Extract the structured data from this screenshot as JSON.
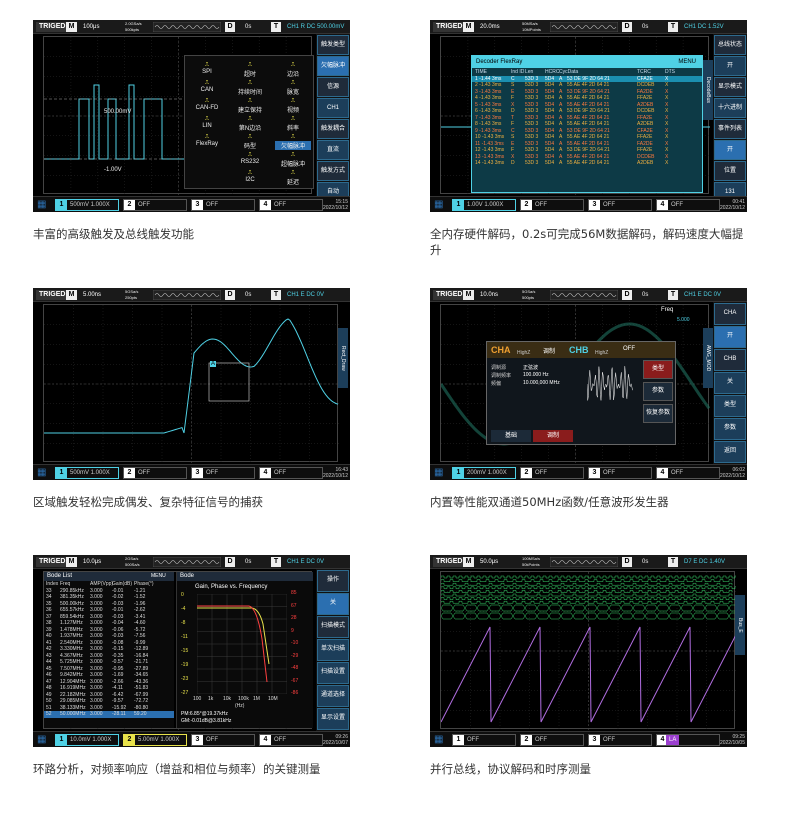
{
  "panels": [
    {
      "id": "trigger",
      "caption": "丰富的高级触发及总线触发功能",
      "status": {
        "mode": "TRIGED",
        "run": "M",
        "timebase": "100μs",
        "sample": "2.0GSa/s",
        "mem": "500kpts",
        "trig_type": "D",
        "delay": "0s",
        "trig_label": "T",
        "trig_info": "CH1 R DC 500.00mV"
      },
      "labels": {
        "level1": "500.00mV",
        "level2": "-1.00V"
      },
      "trigger_menu": [
        [
          "SPI",
          "超时",
          "边沿"
        ],
        [
          "CAN",
          "持续时间",
          "脉宽"
        ],
        [
          "CAN-FD",
          "建立保持",
          "视频"
        ],
        [
          "LIN",
          "第N边沿",
          "斜率"
        ],
        [
          "FlexRay",
          "码型",
          "欠幅脉冲"
        ],
        [
          "",
          "RS232",
          "超幅脉冲"
        ],
        [
          "",
          "I2C",
          "延迟"
        ]
      ],
      "menu_highlight": "欠幅脉冲",
      "side": [
        {
          "label": "触发类型",
          "style": "hd"
        },
        {
          "label": "欠幅脉冲",
          "style": "act"
        },
        {
          "label": "信源",
          "style": "hd"
        },
        {
          "label": "CH1",
          "style": ""
        },
        {
          "label": "触发耦合",
          "style": "hd"
        },
        {
          "label": "直流",
          "style": ""
        },
        {
          "label": "触发方式",
          "style": "hd"
        },
        {
          "label": "自动",
          "style": ""
        },
        {
          "label": "触发极性",
          "style": "hd"
        },
        {
          "label": "负极性",
          "style": ""
        }
      ],
      "channels": [
        {
          "n": "1",
          "label": "500mV 1.000X",
          "state": "on"
        },
        {
          "n": "2",
          "label": "OFF",
          "state": ""
        },
        {
          "n": "3",
          "label": "OFF",
          "state": ""
        },
        {
          "n": "4",
          "label": "OFF",
          "state": ""
        }
      ],
      "clock": {
        "time": "15:15",
        "date": "2022/10/12"
      }
    },
    {
      "id": "decode",
      "caption": "全内存硬件解码，0.2s可完成56M数据解码，解码速度大幅提升",
      "status": {
        "mode": "TRIGED",
        "run": "M",
        "timebase": "20.0ms",
        "sample": "50MSa/s",
        "mem": "10MPoints",
        "trig_type": "D",
        "delay": "0s",
        "trig_label": "T",
        "trig_info": "CH1 DC 1.52V"
      },
      "table_title": "Decoder FlexRay",
      "table_menu": "MENU",
      "table_header": [
        "TIME",
        "Ind ID",
        "Len",
        "HCRC",
        "CycData",
        "",
        "TCRC",
        "DTS"
      ],
      "table_rows": [
        [
          "1 -1.44 3ms",
          "C",
          "53D 3",
          "5D4",
          "A",
          "53 DE 9F 2D 64 21",
          "CFA2E",
          "X"
        ],
        [
          "2 -1.43 3ms",
          "S",
          "53D 3",
          "5D4",
          "A",
          "55 AE 4F 2D 64 21",
          "DCDEB",
          "X"
        ],
        [
          "3 -1.43 3ms",
          "E",
          "53D 3",
          "5D4",
          "A",
          "53 DE 9F 2D 64 21",
          "FA2DE",
          "X"
        ],
        [
          "4 -1.43 3ms",
          "F",
          "53D 3",
          "5D4",
          "A",
          "55 AE 4F 2D 64 21",
          "FFA2E",
          "X"
        ],
        [
          "5 -1.43 3ms",
          "X",
          "53D 3",
          "5D4",
          "A",
          "55 AE 4F 2D 64 21",
          "A2DEB",
          "X"
        ],
        [
          "6 -1.43 3ms",
          "D",
          "53D 3",
          "5D4",
          "A",
          "53 DE 9F 2D 64 21",
          "DCDEB",
          "X"
        ],
        [
          "7 -1.43 3ms",
          "T",
          "53D 3",
          "5D4",
          "A",
          "55 AE 4F 2D 64 21",
          "FFA2E",
          "X"
        ],
        [
          "8 -1.43 3ms",
          "F",
          "53D 3",
          "5D4",
          "A",
          "55 AE 4F 2D 64 21",
          "A2DEB",
          "X"
        ],
        [
          "9 -1.43 3ms",
          "C",
          "53D 3",
          "5D4",
          "A",
          "53 DE 9F 2D 64 21",
          "CFA2E",
          "X"
        ],
        [
          "10 -1.43 3ms",
          "S",
          "53D 3",
          "5D4",
          "A",
          "55 AE 4F 2D 64 21",
          "FFA2E",
          "X"
        ],
        [
          "11 -1.43 3ms",
          "E",
          "53D 3",
          "5D4",
          "A",
          "55 AE 4F 2D 64 21",
          "FA2DE",
          "X"
        ],
        [
          "12 -1.43 3ms",
          "F",
          "53D 3",
          "5D4",
          "A",
          "53 DE 9F 2D 64 21",
          "FFA2E",
          "X"
        ],
        [
          "13 -1.43 3ms",
          "X",
          "53D 3",
          "5D4",
          "A",
          "55 AE 4F 2D 64 21",
          "DCDEB",
          "X"
        ],
        [
          "14 -1.43 3ms",
          "D",
          "53D 3",
          "5D4",
          "A",
          "55 AE 4F 2D 64 21",
          "A2DEB",
          "X"
        ]
      ],
      "side": [
        {
          "label": "总线状态",
          "style": "hd"
        },
        {
          "label": "开",
          "style": ""
        },
        {
          "label": "显示模式",
          "style": "hd"
        },
        {
          "label": "十六进制",
          "style": ""
        },
        {
          "label": "事件列表",
          "style": "hd"
        },
        {
          "label": "开",
          "style": "act"
        },
        {
          "label": "位置",
          "style": "hd"
        },
        {
          "label": "131",
          "style": ""
        },
        {
          "label": "返回",
          "style": ""
        }
      ],
      "vertical_tab": "DecodeBus",
      "channels": [
        {
          "n": "1",
          "label": "1.00V 1.000X",
          "state": "on"
        },
        {
          "n": "2",
          "label": "OFF",
          "state": ""
        },
        {
          "n": "3",
          "label": "OFF",
          "state": ""
        },
        {
          "n": "4",
          "label": "OFF",
          "state": ""
        }
      ],
      "clock": {
        "time": "00:41",
        "date": "2022/10/12"
      }
    },
    {
      "id": "zone",
      "caption": "区域触发轻松完成偶发、复杂特征信号的捕获",
      "status": {
        "mode": "TRIGED",
        "run": "M",
        "timebase": "5.00ns",
        "sample": "5GSa/s",
        "mem": "250pts",
        "trig_type": "D",
        "delay": "0s",
        "trig_label": "T",
        "trig_info": "CH1 E DC 0V"
      },
      "vertical_tab": "Rect_Draw",
      "zone_label": "A",
      "channels": [
        {
          "n": "1",
          "label": "500mV 1.000X",
          "state": "on"
        },
        {
          "n": "2",
          "label": "OFF",
          "state": ""
        },
        {
          "n": "3",
          "label": "OFF",
          "state": ""
        },
        {
          "n": "4",
          "label": "OFF",
          "state": ""
        }
      ],
      "clock": {
        "time": "16:43",
        "date": "2022/10/12"
      }
    },
    {
      "id": "awg",
      "caption": "内置等性能双通道50MHz函数/任意波形发生器",
      "status": {
        "mode": "TRIGED",
        "run": "M",
        "timebase": "10.0ns",
        "sample": "5GSa/s",
        "mem": "500pts",
        "trig_type": "D",
        "delay": "0s",
        "trig_label": "T",
        "trig_info": "CH1 E DC 0V"
      },
      "freq_label": "Freq",
      "freq_value": "5.000",
      "dialog": {
        "cha_title": "CHA",
        "cha_load": "HighZ",
        "cha_mode": "调制",
        "chb_title": "CHB",
        "chb_load": "HighZ",
        "chb_state": "OFF",
        "rows": [
          [
            "调制源",
            "正弦波"
          ],
          [
            "调制频率",
            "100.000 Hz"
          ],
          [
            "频偏",
            "10.000,000 MHz"
          ]
        ],
        "buttons": [
          "类型",
          "参数",
          "恢复参数"
        ],
        "tabs": [
          "基础",
          "调制"
        ]
      },
      "side": [
        {
          "label": "CHA",
          "style": "hd"
        },
        {
          "label": "开",
          "style": "act"
        },
        {
          "label": "CHB",
          "style": "hd"
        },
        {
          "label": "关",
          "style": ""
        },
        {
          "label": "类型",
          "style": ""
        },
        {
          "label": "参数",
          "style": ""
        },
        {
          "label": "返回",
          "style": ""
        }
      ],
      "vertical_tab": "AWG_MOD",
      "channels": [
        {
          "n": "1",
          "label": "200mV 1.000X",
          "state": "on"
        },
        {
          "n": "2",
          "label": "OFF",
          "state": ""
        },
        {
          "n": "3",
          "label": "OFF",
          "state": ""
        },
        {
          "n": "4",
          "label": "OFF",
          "state": ""
        }
      ],
      "clock": {
        "time": "06:02",
        "date": "2022/10/12"
      }
    },
    {
      "id": "bode",
      "caption": "环路分析，对频率响应（增益和相位与频率）的关键测量",
      "status": {
        "mode": "TRIGED",
        "run": "M",
        "timebase": "10.0μs",
        "sample": "2GSa/s",
        "mem": "500Sa/s",
        "trig_type": "D",
        "delay": "0s",
        "trig_label": "T",
        "trig_info": "CH1 E DC 0V"
      },
      "list_title": "Bode List",
      "list_header": [
        "Index",
        "Freq",
        "AMP(Vpp)",
        "Gain(dB)",
        "Phase(°)"
      ],
      "list_rows": [
        [
          "33",
          "290.85kHz",
          "3.000",
          "-0.01",
          "-1.21"
        ],
        [
          "34",
          "381.35kHz",
          "3.000",
          "-0.02",
          "-1.52"
        ],
        [
          "35",
          "500.00kHz",
          "3.000",
          "-0.03",
          "-1.96"
        ],
        [
          "36",
          "655.57kHz",
          "3.000",
          "-0.01",
          "-2.62"
        ],
        [
          "37",
          "859.54kHz",
          "3.000",
          "-0.03",
          "-3.41"
        ],
        [
          "38",
          "1.127MHz",
          "3.000",
          "-0.04",
          "-4.60"
        ],
        [
          "39",
          "1.478MHz",
          "3.000",
          "-0.06",
          "-5.72"
        ],
        [
          "40",
          "1.937MHz",
          "3.000",
          "-0.03",
          "-7.56"
        ],
        [
          "41",
          "2.540MHz",
          "3.000",
          "-0.08",
          "-9.99"
        ],
        [
          "42",
          "3.330MHz",
          "3.000",
          "-0.15",
          "-12.89"
        ],
        [
          "43",
          "4.367MHz",
          "3.000",
          "-0.35",
          "-16.84"
        ],
        [
          "44",
          "5.725MHz",
          "3.000",
          "-0.57",
          "-21.71"
        ],
        [
          "45",
          "7.507MHz",
          "3.000",
          "-0.95",
          "-27.89"
        ],
        [
          "46",
          "9.842MHz",
          "3.000",
          "-1.69",
          "-34.65"
        ],
        [
          "47",
          "12.904MHz",
          "3.000",
          "-2.66",
          "-43.36"
        ],
        [
          "48",
          "16.919MHz",
          "3.000",
          "-4.11",
          "-51.83"
        ],
        [
          "49",
          "22.182MHz",
          "3.000",
          "-6.42",
          "-67.99"
        ],
        [
          "50",
          "29.085MHz",
          "3.000",
          "-9.57",
          "-72.72"
        ],
        [
          "51",
          "38.133MHz",
          "3.000",
          "-15.92",
          "-80.80"
        ],
        [
          "52",
          "50.000MHz",
          "3.000",
          "-28.11",
          "59.20"
        ]
      ],
      "graph_title": "Bode",
      "graph_menu": "MENU",
      "plot_title": "Gain, Phase vs. Frequency",
      "x_ticks": [
        "100",
        "1k",
        "10k",
        "100k",
        "1M",
        "10M"
      ],
      "x_unit": "(Hz)",
      "y_left": [
        "0",
        "-4",
        "-8",
        "-11",
        "-15",
        "-19",
        "-23",
        "-27"
      ],
      "y_right": [
        "85",
        "67",
        "28",
        "9",
        "-10",
        "-29",
        "-48",
        "-67",
        "-86"
      ],
      "pm_text": "PM:6.85°@19.37kHz",
      "gm_text": "GM:-0.01dB@3.81kHz",
      "side": [
        {
          "label": "操作",
          "style": "hd"
        },
        {
          "label": "关",
          "style": "act"
        },
        {
          "label": "扫描模式",
          "style": "hd"
        },
        {
          "label": "单次扫描",
          "style": ""
        },
        {
          "label": "扫描设置",
          "style": ""
        },
        {
          "label": "通道选择",
          "style": ""
        },
        {
          "label": "显示设置",
          "style": ""
        }
      ],
      "channels": [
        {
          "n": "1",
          "label": "10.0mV 1.000X",
          "state": "on"
        },
        {
          "n": "2",
          "label": "5.00mV 1.000X",
          "state": "y"
        },
        {
          "n": "3",
          "label": "OFF",
          "state": ""
        },
        {
          "n": "4",
          "label": "OFF",
          "state": ""
        }
      ],
      "clock": {
        "time": "09:26",
        "date": "2022/10/07"
      }
    },
    {
      "id": "parallel",
      "caption": "并行总线，协议解码和时序测量",
      "status": {
        "mode": "TRIGED",
        "run": "M",
        "timebase": "50.0μs",
        "sample": "100MSa/s",
        "mem": "50kPoints",
        "trig_type": "D",
        "delay": "0s",
        "trig_label": "T",
        "trig_info": "D7 E DC 1.40V"
      },
      "vertical_tab": "Bus_E",
      "channels": [
        {
          "n": "1",
          "label": "OFF",
          "state": ""
        },
        {
          "n": "2",
          "label": "OFF",
          "state": ""
        },
        {
          "n": "3",
          "label": "OFF",
          "state": ""
        },
        {
          "n": "4",
          "label": "",
          "state": ""
        }
      ],
      "la_label": "LA",
      "clock": {
        "time": "09:25",
        "date": "2022/10/05"
      }
    }
  ],
  "colors": {
    "ch1": "#4fd1e5",
    "ch2": "#e8e24b",
    "digital": "#39d36b",
    "ramp": "#b06de0",
    "accent": "#2b6fb0"
  }
}
